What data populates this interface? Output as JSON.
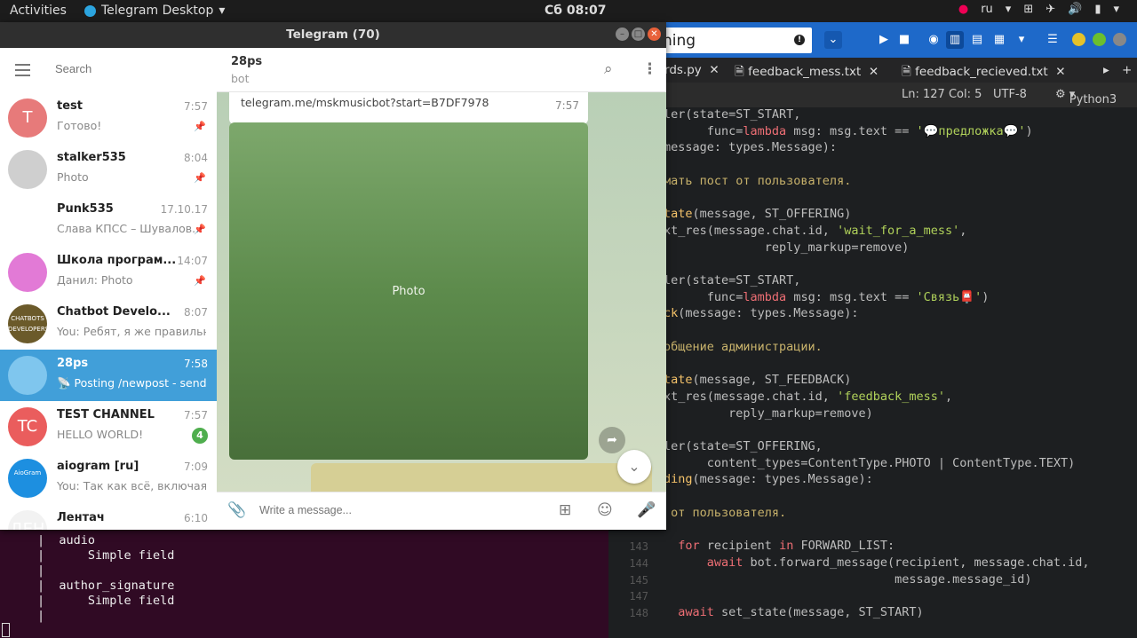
{
  "topbar": {
    "activities": "Activities",
    "app_name": "Telegram Desktop",
    "clock": "Сб 08:07",
    "lang": "ru"
  },
  "telegram": {
    "window_title": "Telegram (70)",
    "search_placeholder": "Search",
    "chats": [
      {
        "name": "test",
        "time": "7:57",
        "preview": "Готово!",
        "avatar_text": "T",
        "avatar_color": "#e77a7a",
        "pinned": true
      },
      {
        "name": "stalker535",
        "time": "8:04",
        "preview": "Photo",
        "avatar_text": "",
        "avatar_color": "#cfcfcf",
        "pinned": true
      },
      {
        "name": "Punk535",
        "time": "17.10.17",
        "preview": "Слава КПСС – Шувалов...",
        "avatar_text": "",
        "avatar_color": "#ffffff",
        "pinned": true
      },
      {
        "name": "Школа програм...",
        "time": "14:07",
        "preview": "Данил: Photo",
        "avatar_text": "",
        "avatar_color": "#e27ad6",
        "pinned": true
      },
      {
        "name": "Chatbot Develo...",
        "time": "8:07",
        "preview": "You: Ребят, я же правильн...",
        "avatar_text": "CHATBOTS DEVELOPERS",
        "avatar_color": "#6b5a2a",
        "pinned": false
      },
      {
        "name": "28ps",
        "time": "7:58",
        "preview": "📡 Posting /newpost - send ...",
        "avatar_text": "",
        "avatar_color": "#7fc6ee",
        "pinned": false
      },
      {
        "name": "TEST CHANNEL",
        "time": "7:57",
        "preview": "HELLO WORLD!",
        "avatar_text": "TC",
        "avatar_color": "#ea5d5d",
        "badge": "4"
      },
      {
        "name": "aiogram [ru]",
        "time": "7:09",
        "preview": "You: Так как всё, включая д...",
        "avatar_text": "AioGram",
        "avatar_color": "#1d8fe0"
      },
      {
        "name": "Лентач",
        "time": "6:10",
        "preview": "",
        "avatar_text": "ДЕН",
        "avatar_color": "#f2f2f2"
      }
    ],
    "active_chat": {
      "name": "28ps",
      "status": "bot",
      "link_text": "telegram.me/mskmusicbot?start=B7DF7978",
      "link_time": "7:57",
      "photo_caption": "Photo",
      "input_placeholder": "Write a message..."
    }
  },
  "editor": {
    "search_value": "hing",
    "tabs": [
      "rds.py",
      "feedback_mess.txt",
      "feedback_recieved.txt"
    ],
    "status_pos": "Ln: 127 Col: 5",
    "status_enc": "UTF-8",
    "status_lang": "Python3",
    "lines": [
      {
        "n": "",
        "segs": [
          [
            "ler(state=ST_START,",
            "id"
          ]
        ]
      },
      {
        "n": "",
        "segs": [
          [
            "      func=",
            "id"
          ],
          [
            "lambda",
            "kw"
          ],
          [
            " msg: msg.text == ",
            "id"
          ],
          [
            "'💬предложка💬'",
            "str"
          ],
          [
            ")",
            "id"
          ]
        ]
      },
      {
        "n": "",
        "segs": [
          [
            "message: types.Message):",
            "id"
          ]
        ]
      },
      {
        "n": "",
        "segs": []
      },
      {
        "n": "",
        "segs": [
          [
            "мать пост от пользователя.",
            "cm"
          ]
        ]
      },
      {
        "n": "",
        "segs": []
      },
      {
        "n": "",
        "segs": [
          [
            "tate",
            "fn"
          ],
          [
            "(message, ST_OFFERING)",
            "id"
          ]
        ]
      },
      {
        "n": "",
        "segs": [
          [
            "xt_res(message.chat.id, ",
            "id"
          ],
          [
            "'wait_for_a_mess'",
            "str"
          ],
          [
            ",",
            "id"
          ]
        ]
      },
      {
        "n": "",
        "segs": [
          [
            "              reply_markup=remove)",
            "id"
          ]
        ]
      },
      {
        "n": "",
        "segs": []
      },
      {
        "n": "",
        "segs": [
          [
            "ler(state=ST_START,",
            "id"
          ]
        ]
      },
      {
        "n": "",
        "segs": [
          [
            "      func=",
            "id"
          ],
          [
            "lambda",
            "kw"
          ],
          [
            " msg: msg.text == ",
            "id"
          ],
          [
            "'Связь📮'",
            "str"
          ],
          [
            ")",
            "id"
          ]
        ]
      },
      {
        "n": "",
        "segs": [
          [
            "ck",
            "fn"
          ],
          [
            "(message: types.Message):",
            "id"
          ]
        ]
      },
      {
        "n": "",
        "segs": []
      },
      {
        "n": "",
        "segs": [
          [
            "общение администрации.",
            "cm"
          ]
        ]
      },
      {
        "n": "",
        "segs": []
      },
      {
        "n": "",
        "segs": [
          [
            "tate",
            "fn"
          ],
          [
            "(message, ST_FEEDBACK)",
            "id"
          ]
        ]
      },
      {
        "n": "",
        "segs": [
          [
            "xt_res(message.chat.id, ",
            "id"
          ],
          [
            "'feedback_mess'",
            "str"
          ],
          [
            ",",
            "id"
          ]
        ]
      },
      {
        "n": "",
        "segs": [
          [
            "         reply_markup=remove)",
            "id"
          ]
        ]
      },
      {
        "n": "",
        "segs": []
      },
      {
        "n": "",
        "segs": [
          [
            "ler(state=ST_OFFERING,",
            "id"
          ]
        ]
      },
      {
        "n": "",
        "segs": [
          [
            "      content_types=ContentType.PHOTO | ContentType.TEXT)",
            "id"
          ]
        ]
      },
      {
        "n": "",
        "segs": [
          [
            "ding",
            "fn"
          ],
          [
            "(message: types.Message):",
            "id"
          ]
        ]
      },
      {
        "n": "",
        "segs": []
      },
      {
        "n": "",
        "segs": [
          [
            " от пользователя.",
            "cm"
          ]
        ]
      },
      {
        "n": "",
        "segs": []
      },
      {
        "n": "143",
        "segs": [
          [
            "  ",
            "id"
          ],
          [
            "for",
            "kw"
          ],
          [
            " recipient ",
            "id"
          ],
          [
            "in",
            "kw"
          ],
          [
            " FORWARD_LIST:",
            "id"
          ]
        ]
      },
      {
        "n": "144",
        "segs": [
          [
            "      ",
            "id"
          ],
          [
            "await",
            "kw"
          ],
          [
            " bot.forward_message(recipient, message.chat.id,",
            "id"
          ]
        ]
      },
      {
        "n": "145",
        "segs": [
          [
            "                                message.message_id)",
            "id"
          ]
        ]
      },
      {
        "n": "147",
        "segs": []
      },
      {
        "n": "148",
        "segs": [
          [
            "  ",
            "id"
          ],
          [
            "await",
            "kw"
          ],
          [
            " set_state(message, ST_START)",
            "id"
          ]
        ]
      }
    ]
  },
  "terminal": {
    "lines": [
      "|  audio",
      "|      Simple field",
      "|",
      "|  author_signature",
      "|      Simple field",
      "|"
    ]
  }
}
